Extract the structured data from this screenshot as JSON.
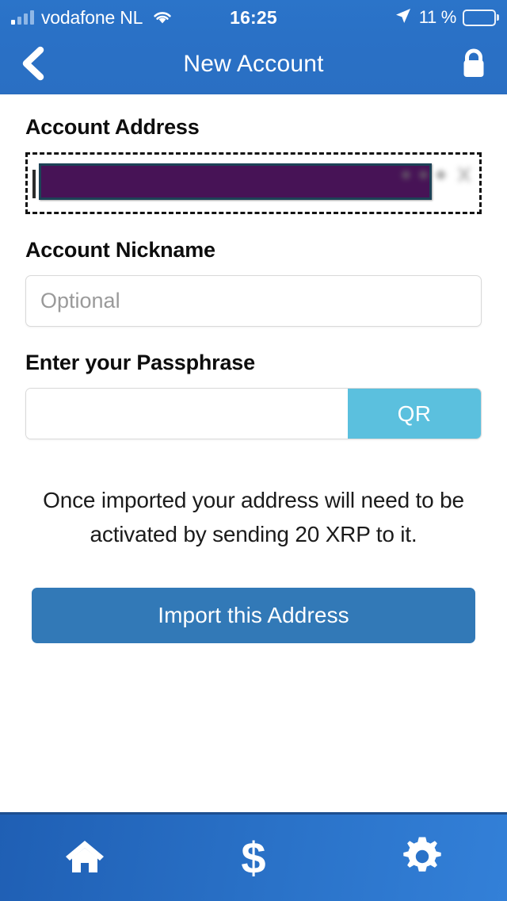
{
  "status_bar": {
    "carrier": "vodafone NL",
    "time": "16:25",
    "battery_percent": "11 %",
    "battery_level": 20,
    "signal_icon": "signal-bars-icon",
    "wifi_icon": "wifi-icon",
    "location_icon": "location-arrow-icon",
    "battery_icon": "battery-icon",
    "battery_color": "#fdc82a"
  },
  "nav_bar": {
    "title": "New Account",
    "back_icon": "chevron-left-icon",
    "lock_icon": "lock-icon",
    "background_color": "#2a71c6"
  },
  "form": {
    "address": {
      "label": "Account Address",
      "value": "",
      "redacted": true,
      "redaction_color": "#471356",
      "clear_icon": "clear-x-icon"
    },
    "nickname": {
      "label": "Account Nickname",
      "placeholder": "Optional",
      "value": ""
    },
    "passphrase": {
      "label": "Enter your Passphrase",
      "placeholder": "",
      "value": "",
      "qr_label": "QR",
      "qr_color": "#5bc0de"
    }
  },
  "info_text": "Once imported your address will need to be activated by sending 20 XRP to it.",
  "import_button": {
    "label": "Import this Address",
    "color": "#3279b7"
  },
  "tab_bar": {
    "items": [
      {
        "name": "home",
        "icon": "home-icon"
      },
      {
        "name": "dollar",
        "icon": "dollar-icon",
        "glyph": "$"
      },
      {
        "name": "settings",
        "icon": "gear-icon"
      }
    ]
  }
}
